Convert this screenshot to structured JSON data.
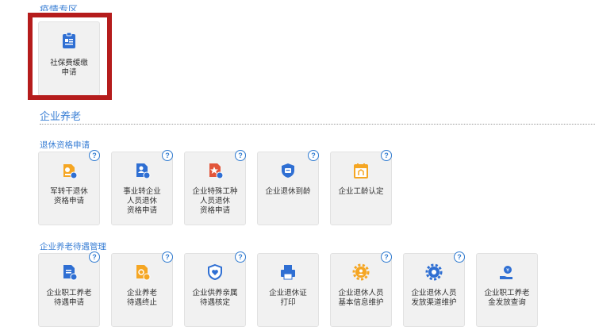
{
  "top_section": {
    "title_cut": "疫情专区",
    "tile": {
      "label": "社保费缓缴\n申请",
      "icon": "document-clipboard-icon"
    }
  },
  "enterprise_pension": {
    "title": "企业养老",
    "retirement_qualification": {
      "title": "退休资格申请",
      "tiles": [
        {
          "label": "军转干退休\n资格申请",
          "icon": "soldier-card-icon",
          "help": "?"
        },
        {
          "label": "事业转企业\n人员退休\n资格申请",
          "icon": "person-doc-icon",
          "help": "?"
        },
        {
          "label": "企业特殊工种\n人员退休\n资格申请",
          "icon": "star-doc-icon",
          "help": "?"
        },
        {
          "label": "企业退休到龄",
          "icon": "shield-icon",
          "help": "?"
        },
        {
          "label": "企业工龄认定",
          "icon": "calendar-icon",
          "help": "?"
        }
      ]
    },
    "pension_treatment": {
      "title": "企业养老待遇管理",
      "tiles": [
        {
          "label": "企业职工养老\n待遇申请",
          "icon": "doc-edit-icon",
          "help": "?"
        },
        {
          "label": "企业养老\n待遇终止",
          "icon": "doc-stop-icon",
          "help": "?"
        },
        {
          "label": "企业供养亲属\n待遇核定",
          "icon": "heart-shield-icon",
          "help": "?"
        },
        {
          "label": "企业退休证\n打印",
          "icon": "printer-icon"
        },
        {
          "label": "企业退休人员\n基本信息维护",
          "icon": "gear-person-icon",
          "help": "?"
        },
        {
          "label": "企业退休人员\n发放渠道维护",
          "icon": "gear-route-icon",
          "help": "?"
        },
        {
          "label": "企业职工养老\n金发放查询",
          "icon": "hand-coin-icon"
        }
      ]
    }
  },
  "colors": {
    "accent": "#3a7fd5",
    "highlight": "#b51c1c",
    "orange": "#f5a623",
    "red": "#e2553a",
    "blue": "#2f6fd3"
  }
}
